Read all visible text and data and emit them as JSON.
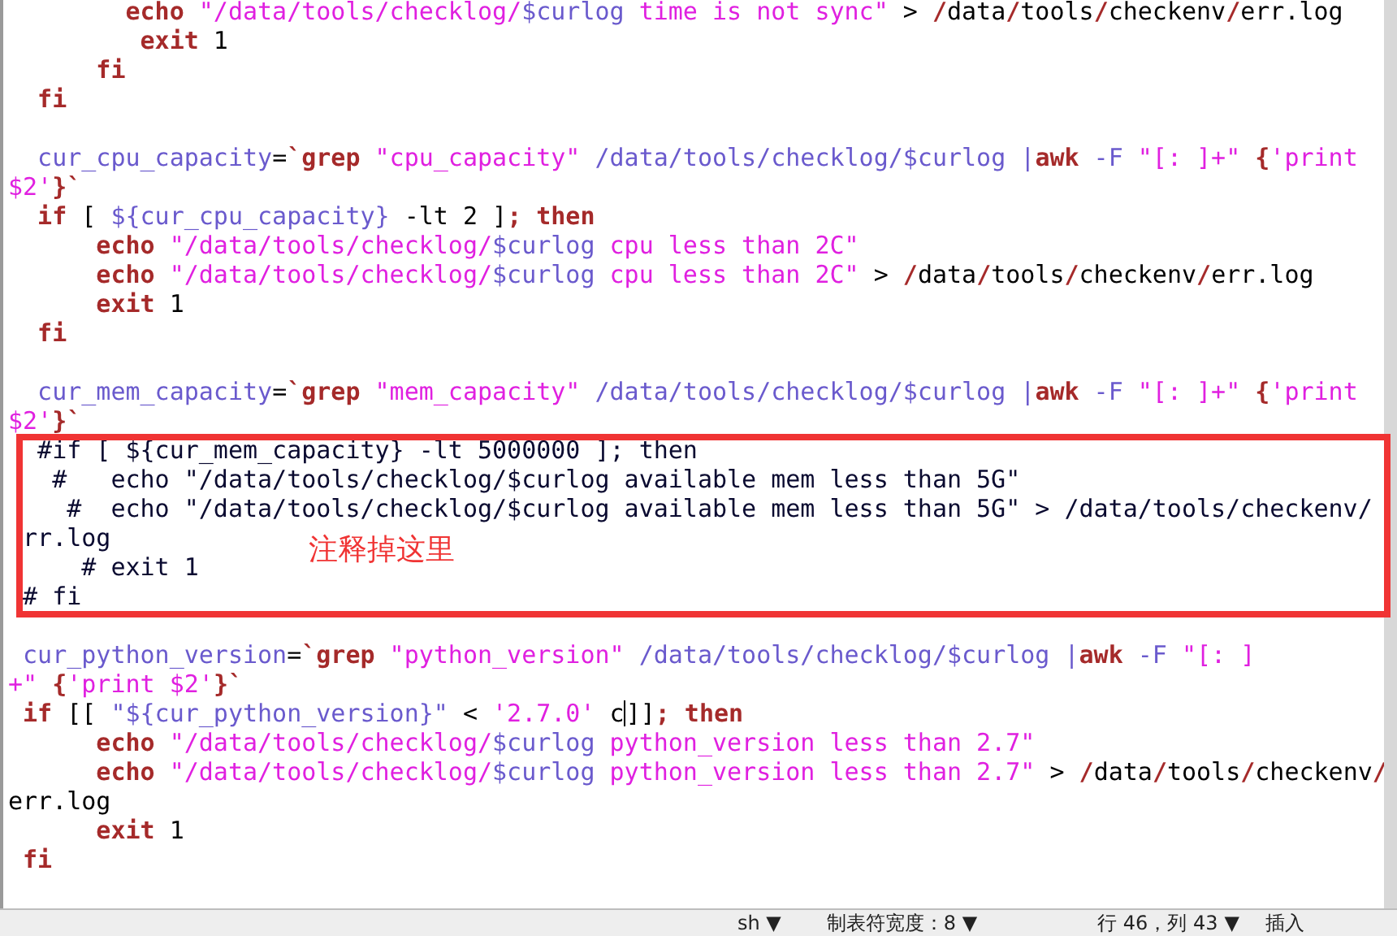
{
  "editor": {
    "lines": [
      {
        "kind": "code",
        "segments": [
          {
            "kind": "keyword",
            "text": "        echo"
          },
          {
            "kind": "string",
            "text": " \"/data/tools/checklog/"
          },
          {
            "kind": "variable",
            "text": "$curlog"
          },
          {
            "kind": "string",
            "text": " time is not sync\""
          },
          {
            "kind": "plain",
            "text": " > "
          },
          {
            "kind": "keyword",
            "text": "/"
          },
          {
            "kind": "plain",
            "text": "data"
          },
          {
            "kind": "keyword",
            "text": "/"
          },
          {
            "kind": "plain",
            "text": "tools"
          },
          {
            "kind": "keyword",
            "text": "/"
          },
          {
            "kind": "plain",
            "text": "checkenv"
          },
          {
            "kind": "keyword",
            "text": "/"
          },
          {
            "kind": "plain",
            "text": "err.log"
          }
        ]
      },
      {
        "kind": "code",
        "segments": [
          {
            "kind": "keyword",
            "text": "         exit"
          },
          {
            "kind": "plain",
            "text": " 1"
          }
        ]
      },
      {
        "kind": "code",
        "segments": [
          {
            "kind": "keyword",
            "text": "      fi"
          }
        ]
      },
      {
        "kind": "code",
        "segments": [
          {
            "kind": "keyword",
            "text": "  fi"
          }
        ]
      },
      {
        "kind": "blank"
      },
      {
        "kind": "code",
        "segments": [
          {
            "kind": "variable",
            "text": "  cur_cpu_capacity"
          },
          {
            "kind": "plain",
            "text": "="
          },
          {
            "kind": "keyword",
            "text": "`grep"
          },
          {
            "kind": "string",
            "text": " \"cpu_capacity\""
          },
          {
            "kind": "variable",
            "text": " /data/tools/checklog/$curlog |"
          },
          {
            "kind": "keyword",
            "text": "awk"
          },
          {
            "kind": "variable",
            "text": " -F "
          },
          {
            "kind": "string",
            "text": "\"[: ]+\""
          },
          {
            "kind": "keyword",
            "text": " {"
          },
          {
            "kind": "string",
            "text": "'print"
          }
        ]
      },
      {
        "kind": "code",
        "segments": [
          {
            "kind": "string",
            "text": "$2'"
          },
          {
            "kind": "keyword",
            "text": "}`"
          }
        ]
      },
      {
        "kind": "code",
        "segments": [
          {
            "kind": "keyword",
            "text": "  if"
          },
          {
            "kind": "plain",
            "text": " [ "
          },
          {
            "kind": "variable",
            "text": "${cur_cpu_capacity}"
          },
          {
            "kind": "plain",
            "text": " -lt 2 ]"
          },
          {
            "kind": "keyword",
            "text": "; then"
          }
        ]
      },
      {
        "kind": "code",
        "segments": [
          {
            "kind": "keyword",
            "text": "      echo"
          },
          {
            "kind": "string",
            "text": " \"/data/tools/checklog/"
          },
          {
            "kind": "variable",
            "text": "$curlog"
          },
          {
            "kind": "string",
            "text": " cpu less than 2C\""
          }
        ]
      },
      {
        "kind": "code",
        "segments": [
          {
            "kind": "keyword",
            "text": "      echo"
          },
          {
            "kind": "string",
            "text": " \"/data/tools/checklog/"
          },
          {
            "kind": "variable",
            "text": "$curlog"
          },
          {
            "kind": "string",
            "text": " cpu less than 2C\""
          },
          {
            "kind": "plain",
            "text": " > "
          },
          {
            "kind": "keyword",
            "text": "/"
          },
          {
            "kind": "plain",
            "text": "data"
          },
          {
            "kind": "keyword",
            "text": "/"
          },
          {
            "kind": "plain",
            "text": "tools"
          },
          {
            "kind": "keyword",
            "text": "/"
          },
          {
            "kind": "plain",
            "text": "checkenv"
          },
          {
            "kind": "keyword",
            "text": "/"
          },
          {
            "kind": "plain",
            "text": "err.log"
          }
        ]
      },
      {
        "kind": "code",
        "segments": [
          {
            "kind": "keyword",
            "text": "      exit"
          },
          {
            "kind": "plain",
            "text": " 1"
          }
        ]
      },
      {
        "kind": "code",
        "segments": [
          {
            "kind": "keyword",
            "text": "  fi"
          }
        ]
      },
      {
        "kind": "blank"
      },
      {
        "kind": "code",
        "segments": [
          {
            "kind": "variable",
            "text": "  cur_mem_capacity"
          },
          {
            "kind": "plain",
            "text": "="
          },
          {
            "kind": "keyword",
            "text": "`grep"
          },
          {
            "kind": "string",
            "text": " \"mem_capacity\""
          },
          {
            "kind": "variable",
            "text": " /data/tools/checklog/$curlog |"
          },
          {
            "kind": "keyword",
            "text": "awk"
          },
          {
            "kind": "variable",
            "text": " -F "
          },
          {
            "kind": "string",
            "text": "\"[: ]+\""
          },
          {
            "kind": "keyword",
            "text": " {"
          },
          {
            "kind": "string",
            "text": "'print"
          }
        ]
      },
      {
        "kind": "code",
        "segments": [
          {
            "kind": "string",
            "text": "$2'"
          },
          {
            "kind": "keyword",
            "text": "}`"
          }
        ]
      },
      {
        "kind": "code",
        "segments": [
          {
            "kind": "comment",
            "text": "  #if [ ${cur_mem_capacity} -lt 5000000 ]; then"
          }
        ]
      },
      {
        "kind": "code",
        "segments": [
          {
            "kind": "comment",
            "text": "   #   echo \"/data/tools/checklog/$curlog available mem less than 5G\""
          }
        ]
      },
      {
        "kind": "code",
        "segments": [
          {
            "kind": "comment",
            "text": "    #  echo \"/data/tools/checklog/$curlog available mem less than 5G\" > /data/tools/checkenv/"
          }
        ]
      },
      {
        "kind": "code",
        "segments": [
          {
            "kind": "comment",
            "text": " rr.log"
          }
        ]
      },
      {
        "kind": "code",
        "segments": [
          {
            "kind": "comment",
            "text": "     # exit 1"
          }
        ]
      },
      {
        "kind": "code",
        "segments": [
          {
            "kind": "comment",
            "text": " # fi"
          }
        ]
      },
      {
        "kind": "blank"
      },
      {
        "kind": "code",
        "segments": [
          {
            "kind": "variable",
            "text": " cur_python_version"
          },
          {
            "kind": "plain",
            "text": "="
          },
          {
            "kind": "keyword",
            "text": "`grep"
          },
          {
            "kind": "string",
            "text": " \"python_version\""
          },
          {
            "kind": "variable",
            "text": " /data/tools/checklog/$curlog |"
          },
          {
            "kind": "keyword",
            "text": "awk"
          },
          {
            "kind": "variable",
            "text": " -F "
          },
          {
            "kind": "string",
            "text": "\"[: ]"
          }
        ]
      },
      {
        "kind": "code",
        "segments": [
          {
            "kind": "string",
            "text": "+\""
          },
          {
            "kind": "keyword",
            "text": " {"
          },
          {
            "kind": "string",
            "text": "'print $2'"
          },
          {
            "kind": "keyword",
            "text": "}`"
          }
        ]
      },
      {
        "kind": "code",
        "segments": [
          {
            "kind": "keyword",
            "text": " if"
          },
          {
            "kind": "plain",
            "text": " [[ "
          },
          {
            "kind": "variable",
            "text": "\"${cur_python_version}\""
          },
          {
            "kind": "plain",
            "text": " < "
          },
          {
            "kind": "string",
            "text": "'2.7.0'"
          },
          {
            "kind": "plain",
            "text": " c"
          },
          {
            "kind": "cursor"
          },
          {
            "kind": "plain",
            "text": "]]"
          },
          {
            "kind": "keyword",
            "text": "; then"
          }
        ]
      },
      {
        "kind": "code",
        "segments": [
          {
            "kind": "keyword",
            "text": "      echo"
          },
          {
            "kind": "string",
            "text": " \"/data/tools/checklog/"
          },
          {
            "kind": "variable",
            "text": "$curlog"
          },
          {
            "kind": "string",
            "text": " python_version less than 2.7\""
          }
        ]
      },
      {
        "kind": "code",
        "segments": [
          {
            "kind": "keyword",
            "text": "      echo"
          },
          {
            "kind": "string",
            "text": " \"/data/tools/checklog/"
          },
          {
            "kind": "variable",
            "text": "$curlog"
          },
          {
            "kind": "string",
            "text": " python_version less than 2.7\""
          },
          {
            "kind": "plain",
            "text": " > "
          },
          {
            "kind": "keyword",
            "text": "/"
          },
          {
            "kind": "plain",
            "text": "data"
          },
          {
            "kind": "keyword",
            "text": "/"
          },
          {
            "kind": "plain",
            "text": "tools"
          },
          {
            "kind": "keyword",
            "text": "/"
          },
          {
            "kind": "plain",
            "text": "checkenv"
          },
          {
            "kind": "keyword",
            "text": "/"
          }
        ]
      },
      {
        "kind": "code",
        "segments": [
          {
            "kind": "plain",
            "text": "err.log"
          }
        ]
      },
      {
        "kind": "code",
        "segments": [
          {
            "kind": "keyword",
            "text": "      exit"
          },
          {
            "kind": "plain",
            "text": " 1"
          }
        ]
      },
      {
        "kind": "code",
        "segments": [
          {
            "kind": "keyword",
            "text": " fi"
          }
        ]
      }
    ]
  },
  "annotation": {
    "note": "注释掉这里"
  },
  "status_bar": {
    "language": "sh",
    "language_caret": "▼",
    "tab_width": "制表符宽度：8",
    "tab_width_caret": "▼",
    "position": "行 46，列 43",
    "mode_caret": "▼",
    "mode": "插入"
  }
}
